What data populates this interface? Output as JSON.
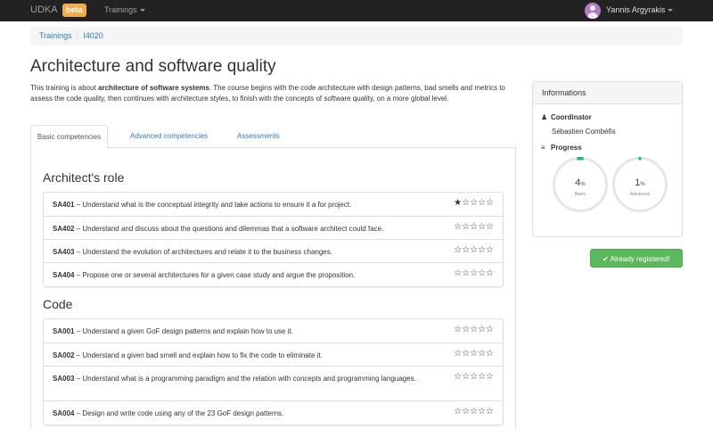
{
  "navbar": {
    "brand": "UDKA",
    "badge": "beta",
    "menu_trainings": "Trainings",
    "user_name": "Yannis Argyrakis"
  },
  "breadcrumb": [
    "Trainings",
    "I4020"
  ],
  "page": {
    "title": "Architecture and software quality",
    "description_before": "This training is about ",
    "description_bold": "architecture of software systems",
    "description_after": ". The course begins with the code architecture with design patterns, bad smells and metrics to assess the code quality, then continues with architecture styles, to finish with the concepts of software quality, on a more global level."
  },
  "tabs": [
    "Basic competencies",
    "Advanced competencies",
    "Assessments"
  ],
  "sections": [
    {
      "title": "Architect's role",
      "items": [
        {
          "code": "SA401",
          "text": " – Understand what is the conceptual integrity and take actions to ensure it a for project.",
          "stars": "★☆☆☆☆"
        },
        {
          "code": "SA402",
          "text": " – Understand and discuss about the questions and dilemmas that a software architect could face.",
          "stars": "☆☆☆☆☆"
        },
        {
          "code": "SA403",
          "text": " – Understand the evolution of architectures and relate it to the business changes.",
          "stars": "☆☆☆☆☆"
        },
        {
          "code": "SA404",
          "text": " – Propose one or several architectures for a given case study and argue the proposition.",
          "stars": "☆☆☆☆☆"
        }
      ]
    },
    {
      "title": "Code",
      "items": [
        {
          "code": "SA001",
          "text": " – Understand a given GoF design patterns and explain how to use it.",
          "stars": "☆☆☆☆☆"
        },
        {
          "code": "SA002",
          "text": " – Understand a given bad smell and explain how to fix the code to eliminate it.",
          "stars": "☆☆☆☆☆"
        },
        {
          "code": "SA003",
          "text": " – Understand what is a programming paradigm and the relation with concepts and programming languages.",
          "stars": "☆☆☆☆☆"
        },
        {
          "code": "SA004",
          "text": " – Design and write code using any of the 23 GoF design patterns.",
          "stars": "☆☆☆☆☆"
        }
      ]
    }
  ],
  "info": {
    "heading": "Informations",
    "coordinator_label": "Coordinator",
    "coordinator_name": "Sébastien Combéfis",
    "progress_label": "Progress",
    "basic": {
      "value": "4",
      "unit": "%",
      "label": "Basic",
      "percent": 4
    },
    "advanced": {
      "value": "1",
      "unit": "%",
      "label": "Advanced",
      "percent": 1
    }
  },
  "register_button": "Already registered!",
  "colors": {
    "accent": "#337ab7",
    "progress": "#1ab394",
    "success": "#5cb85c",
    "badge": "#f0ad4e"
  }
}
